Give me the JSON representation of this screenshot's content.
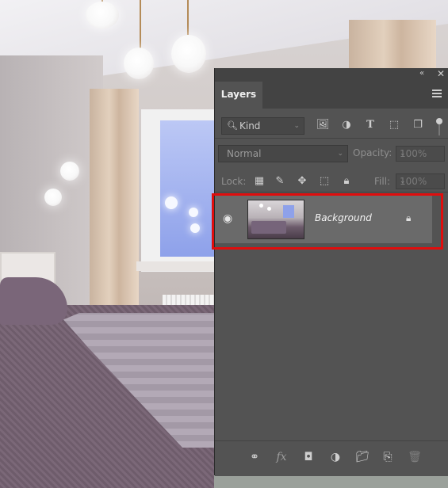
{
  "panel": {
    "collapse_glyph": "«",
    "close_glyph": "✕",
    "tab_label": "Layers"
  },
  "filter": {
    "kind_label": "Kind",
    "kind_chevron": "⌄",
    "icons": [
      "image-filter-icon",
      "adjustment-filter-icon",
      "type-filter-icon",
      "shape-filter-icon",
      "smart-object-filter-icon"
    ]
  },
  "blend": {
    "mode": "Normal",
    "opacity_label": "Opacity:",
    "opacity_value": "100%"
  },
  "lock": {
    "label": "Lock:",
    "fill_label": "Fill:",
    "fill_value": "100%"
  },
  "layers": [
    {
      "name": "Background",
      "visible": true,
      "locked": true,
      "selected": true
    }
  ],
  "bottom_bar": {
    "fx_label": "fx"
  },
  "colors": {
    "panel_bg": "#535353",
    "selected_row": "#6a6a6a",
    "highlight": "#e00d0d"
  }
}
